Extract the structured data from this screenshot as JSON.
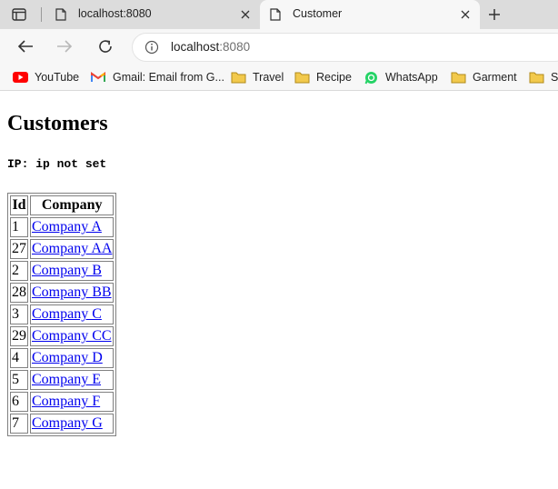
{
  "browser": {
    "tabs": [
      {
        "title": "localhost:8080",
        "active": false
      },
      {
        "title": "Customer",
        "active": true
      }
    ],
    "address": {
      "host": "localhost",
      "port": ":8080"
    },
    "bookmarks": [
      {
        "label": "YouTube",
        "icon": "youtube-icon"
      },
      {
        "label": "Gmail: Email from G...",
        "icon": "gmail-icon"
      },
      {
        "label": "Travel",
        "icon": "folder-icon"
      },
      {
        "label": "Recipe",
        "icon": "folder-icon"
      },
      {
        "label": "WhatsApp",
        "icon": "whatsapp-icon"
      },
      {
        "label": "Garment",
        "icon": "folder-icon"
      },
      {
        "label": "Sc",
        "icon": "folder-icon"
      }
    ],
    "colors": {
      "youtube": "#ff0000",
      "whatsapp": "#25d366",
      "folder": "#f2c94c",
      "link": "#0000ee"
    }
  },
  "page": {
    "title": "Customers",
    "ip_label": "IP: ip not set",
    "table": {
      "headers": [
        "Id",
        "Company"
      ],
      "rows": [
        {
          "id": "1",
          "company": "Company A"
        },
        {
          "id": "27",
          "company": "Company AA"
        },
        {
          "id": "2",
          "company": "Company B"
        },
        {
          "id": "28",
          "company": "Company BB"
        },
        {
          "id": "3",
          "company": "Company C"
        },
        {
          "id": "29",
          "company": "Company CC"
        },
        {
          "id": "4",
          "company": "Company D"
        },
        {
          "id": "5",
          "company": "Company E"
        },
        {
          "id": "6",
          "company": "Company F"
        },
        {
          "id": "7",
          "company": "Company G"
        }
      ]
    }
  }
}
